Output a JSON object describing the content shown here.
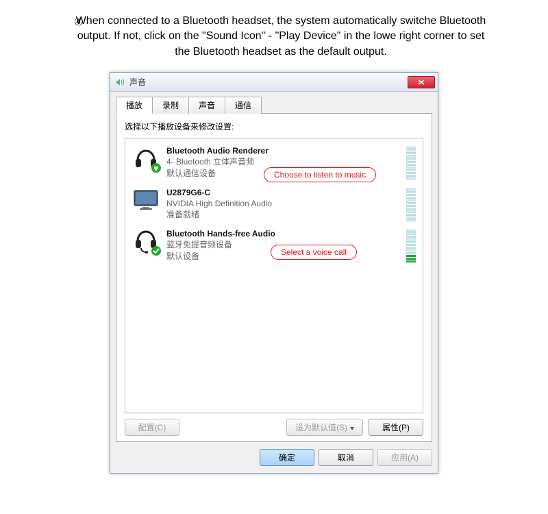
{
  "instruction": {
    "number": "④",
    "text": "When connected to a Bluetooth headset, the system automatically switche Bluetooth output. If not, click on the \"Sound Icon\" - \"Play Device\" in the lowe right corner to set the Bluetooth headset as the default output."
  },
  "dialog": {
    "title": "声音",
    "tabs": [
      "播放",
      "录制",
      "声音",
      "通信"
    ],
    "active_tab": 0,
    "panel_label": "选择以下播放设备来修改设置:",
    "devices": [
      {
        "name": "Bluetooth Audio Renderer",
        "line2": "4- Bluetooth 立体声音频",
        "line3": "默认通信设备",
        "icon": "headphones",
        "badge": "phone",
        "level_on": 0
      },
      {
        "name": "U2879G6-C",
        "line2": "NVIDIA High Definition Audio",
        "line3": "准备就绪",
        "icon": "monitor",
        "badge": "",
        "level_on": 0
      },
      {
        "name": "Bluetooth Hands-free Audio",
        "line2": "蓝牙免提音频设备",
        "line3": "默认设备",
        "icon": "headset",
        "badge": "check",
        "level_on": 3
      }
    ],
    "callouts": {
      "music": "Choose to listen to music",
      "voice": "Select a voice call"
    },
    "buttons": {
      "configure": "配置(C)",
      "set_default": "设为默认值(S)",
      "properties": "属性(P)",
      "ok": "确定",
      "cancel": "取消",
      "apply": "应用(A)"
    }
  }
}
